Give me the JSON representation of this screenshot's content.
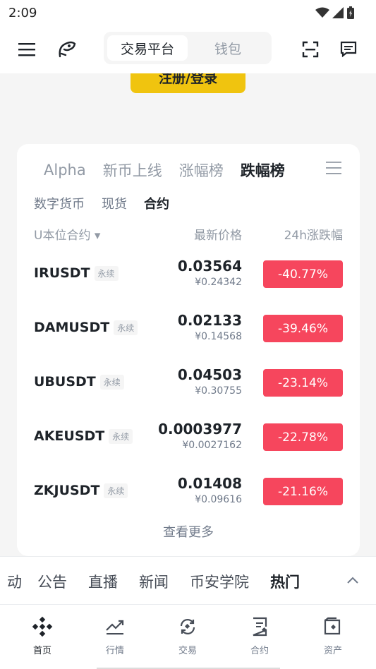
{
  "status": {
    "time": "2:09"
  },
  "header": {
    "segment": [
      "交易平台",
      "钱包"
    ]
  },
  "register": {
    "label": "注册/登录"
  },
  "card": {
    "tabs": [
      "Alpha",
      "新币上线",
      "涨幅榜",
      "跌幅榜"
    ],
    "active_tab": "跌幅榜",
    "subtabs": [
      "数字货币",
      "现货",
      "合约"
    ],
    "active_subtab": "合约",
    "columns": {
      "symbol": "U本位合约 ▾",
      "price": "最新价格",
      "change": "24h涨跌幅"
    },
    "rows": [
      {
        "symbol": "IRUSDT",
        "tag": "永续",
        "price": "0.03564",
        "cny": "¥0.24342",
        "change": "-40.77%"
      },
      {
        "symbol": "DAMUSDT",
        "tag": "永续",
        "price": "0.02133",
        "cny": "¥0.14568",
        "change": "-39.46%"
      },
      {
        "symbol": "UBUSDT",
        "tag": "永续",
        "price": "0.04503",
        "cny": "¥0.30755",
        "change": "-23.14%"
      },
      {
        "symbol": "AKEUSDT",
        "tag": "永续",
        "price": "0.0003977",
        "cny": "¥0.0027162",
        "change": "-22.78%"
      },
      {
        "symbol": "ZKJUSDT",
        "tag": "永续",
        "price": "0.01408",
        "cny": "¥0.09616",
        "change": "-21.16%"
      }
    ],
    "more": "查看更多"
  },
  "feed_tabs": [
    "动",
    "公告",
    "直播",
    "新闻",
    "币安学院",
    "热门"
  ],
  "feed_active": "热门",
  "bottom_nav": [
    "首页",
    "行情",
    "交易",
    "合约",
    "资产"
  ],
  "colors": {
    "brand": "#F0B90B",
    "down": "#F6465D",
    "text": "#1E2329",
    "muted": "#929AA5"
  }
}
